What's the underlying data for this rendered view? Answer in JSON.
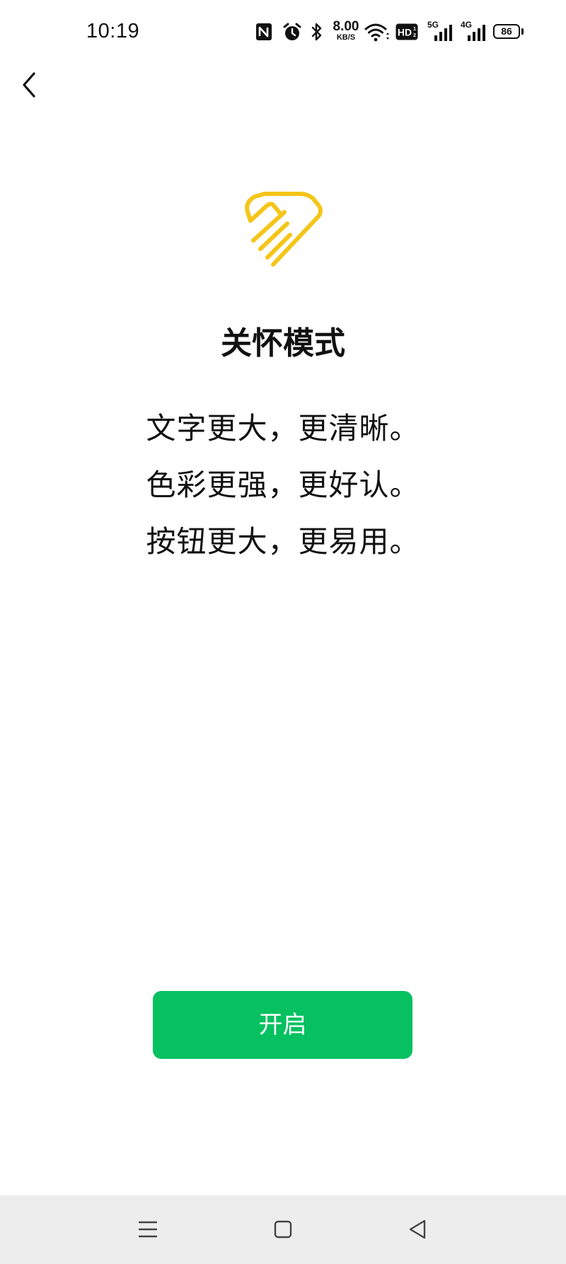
{
  "status_bar": {
    "time": "10:19",
    "net_speed_value": "8.00",
    "net_speed_unit": "KB/S",
    "hd_badge": "HD",
    "signal_1_label": "5G",
    "signal_2_label": "4G",
    "battery_level": "86",
    "icons": [
      "nfc-icon",
      "alarm-icon",
      "bluetooth-icon",
      "wifi-icon",
      "hd-voice-icon",
      "signal-5g-icon",
      "signal-4g-icon",
      "battery-icon"
    ]
  },
  "header": {
    "back_icon": "chevron-left-icon"
  },
  "hero": {
    "logo_icon": "care-heart-hand-icon",
    "logo_color": "#f5c518",
    "title": "关怀模式",
    "features": [
      "文字更大，更清晰。",
      "色彩更强，更好认。",
      "按钮更大，更易用。"
    ]
  },
  "action": {
    "enable_label": "开启",
    "button_color": "#07c160"
  },
  "nav_bar": {
    "menu_icon": "menu-icon",
    "home_icon": "home-square-icon",
    "back_icon": "back-triangle-icon"
  }
}
